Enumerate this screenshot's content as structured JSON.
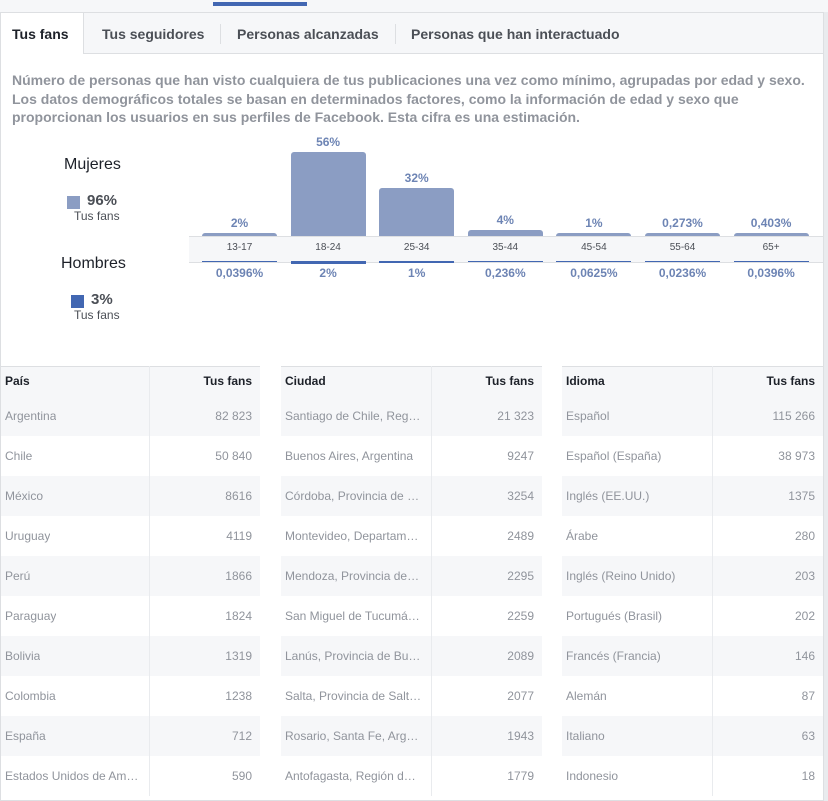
{
  "tabs": [
    {
      "label": "Tus fans",
      "active": true
    },
    {
      "label": "Tus seguidores",
      "active": false
    },
    {
      "label": "Personas alcanzadas",
      "active": false
    },
    {
      "label": "Personas que han interactuado",
      "active": false
    }
  ],
  "description": "Número de personas que han visto cualquiera de tus publicaciones una vez como mínimo, agrupadas por edad y sexo. Los datos demográficos totales se basan en determinados factores, como la información de edad y sexo que proporcionan los usuarios en sus perfiles de Facebook. Esta cifra es una estimación.",
  "legend": {
    "women": {
      "title": "Mujeres",
      "pct": "96%",
      "sub": "Tus fans",
      "color": "#8b9dc3"
    },
    "men": {
      "title": "Hombres",
      "pct": "3%",
      "sub": "Tus fans",
      "color": "#4267b2"
    }
  },
  "chart_data": {
    "type": "bar",
    "categories": [
      "13-17",
      "18-24",
      "25-34",
      "35-44",
      "45-54",
      "55-64",
      "65+"
    ],
    "series": [
      {
        "name": "Mujeres",
        "values": [
          2,
          56,
          32,
          4,
          1,
          0.273,
          0.403
        ],
        "labels": [
          "2%",
          "56%",
          "32%",
          "4%",
          "1%",
          "0,273%",
          "0,403%"
        ]
      },
      {
        "name": "Hombres",
        "values": [
          0.0396,
          2,
          1,
          0.236,
          0.0625,
          0.0236,
          0.0396
        ],
        "labels": [
          "0,0396%",
          "2%",
          "1%",
          "0,236%",
          "0,0625%",
          "0,0236%",
          "0,0396%"
        ]
      }
    ]
  },
  "tables": [
    {
      "headers": [
        "País",
        "Tus fans"
      ],
      "rows": [
        [
          "Argentina",
          "82 823"
        ],
        [
          "Chile",
          "50 840"
        ],
        [
          "México",
          "8616"
        ],
        [
          "Uruguay",
          "4119"
        ],
        [
          "Perú",
          "1866"
        ],
        [
          "Paraguay",
          "1824"
        ],
        [
          "Bolivia",
          "1319"
        ],
        [
          "Colombia",
          "1238"
        ],
        [
          "España",
          "712"
        ],
        [
          "Estados Unidos de Am…",
          "590"
        ]
      ]
    },
    {
      "headers": [
        "Ciudad",
        "Tus fans"
      ],
      "rows": [
        [
          "Santiago de Chile, Reg…",
          "21 323"
        ],
        [
          "Buenos Aires, Argentina",
          "9247"
        ],
        [
          "Córdoba, Provincia de …",
          "3254"
        ],
        [
          "Montevideo, Departam…",
          "2489"
        ],
        [
          "Mendoza, Provincia de…",
          "2295"
        ],
        [
          "San Miguel de Tucumá…",
          "2259"
        ],
        [
          "Lanús, Provincia de Bu…",
          "2089"
        ],
        [
          "Salta, Provincia de Salt…",
          "2077"
        ],
        [
          "Rosario, Santa Fe, Arg…",
          "1943"
        ],
        [
          "Antofagasta, Región d…",
          "1779"
        ]
      ]
    },
    {
      "headers": [
        "Idioma",
        "Tus fans"
      ],
      "rows": [
        [
          "Español",
          "115 266"
        ],
        [
          "Español (España)",
          "38 973"
        ],
        [
          "Inglés (EE.UU.)",
          "1375"
        ],
        [
          "Árabe",
          "280"
        ],
        [
          "Inglés (Reino Unido)",
          "203"
        ],
        [
          "Portugués (Brasil)",
          "202"
        ],
        [
          "Francés (Francia)",
          "146"
        ],
        [
          "Alemán",
          "87"
        ],
        [
          "Italiano",
          "63"
        ],
        [
          "Indonesio",
          "18"
        ]
      ]
    }
  ]
}
